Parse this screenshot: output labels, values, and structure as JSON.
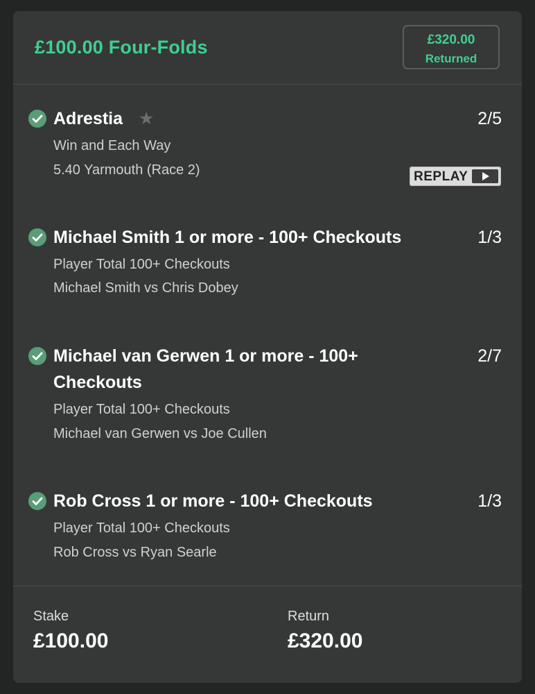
{
  "bet": {
    "title": "£100.00 Four-Folds",
    "returned_amount": "£320.00",
    "returned_label": "Returned"
  },
  "selections": [
    {
      "name": "Adrestia",
      "odds": "2/5",
      "market": "Win and Each Way",
      "event": "5.40 Yarmouth (Race 2)",
      "has_star": true,
      "replay_label": "REPLAY"
    },
    {
      "name": "Michael Smith 1 or more - 100+ Checkouts",
      "odds": "1/3",
      "market": "Player Total 100+ Checkouts",
      "event": "Michael Smith vs Chris Dobey"
    },
    {
      "name": "Michael van Gerwen 1 or more - 100+ Checkouts",
      "odds": "2/7",
      "market": "Player Total 100+ Checkouts",
      "event": "Michael van Gerwen vs Joe Cullen"
    },
    {
      "name": "Rob Cross 1 or more - 100+ Checkouts",
      "odds": "1/3",
      "market": "Player Total 100+ Checkouts",
      "event": "Rob Cross vs Ryan Searle"
    }
  ],
  "footer": {
    "stake_label": "Stake",
    "stake_value": "£100.00",
    "return_label": "Return",
    "return_value": "£320.00"
  },
  "colors": {
    "accent_green": "#3ed08f",
    "check_green": "#5a9d78",
    "card_bg": "#363838",
    "page_bg": "#232424"
  }
}
